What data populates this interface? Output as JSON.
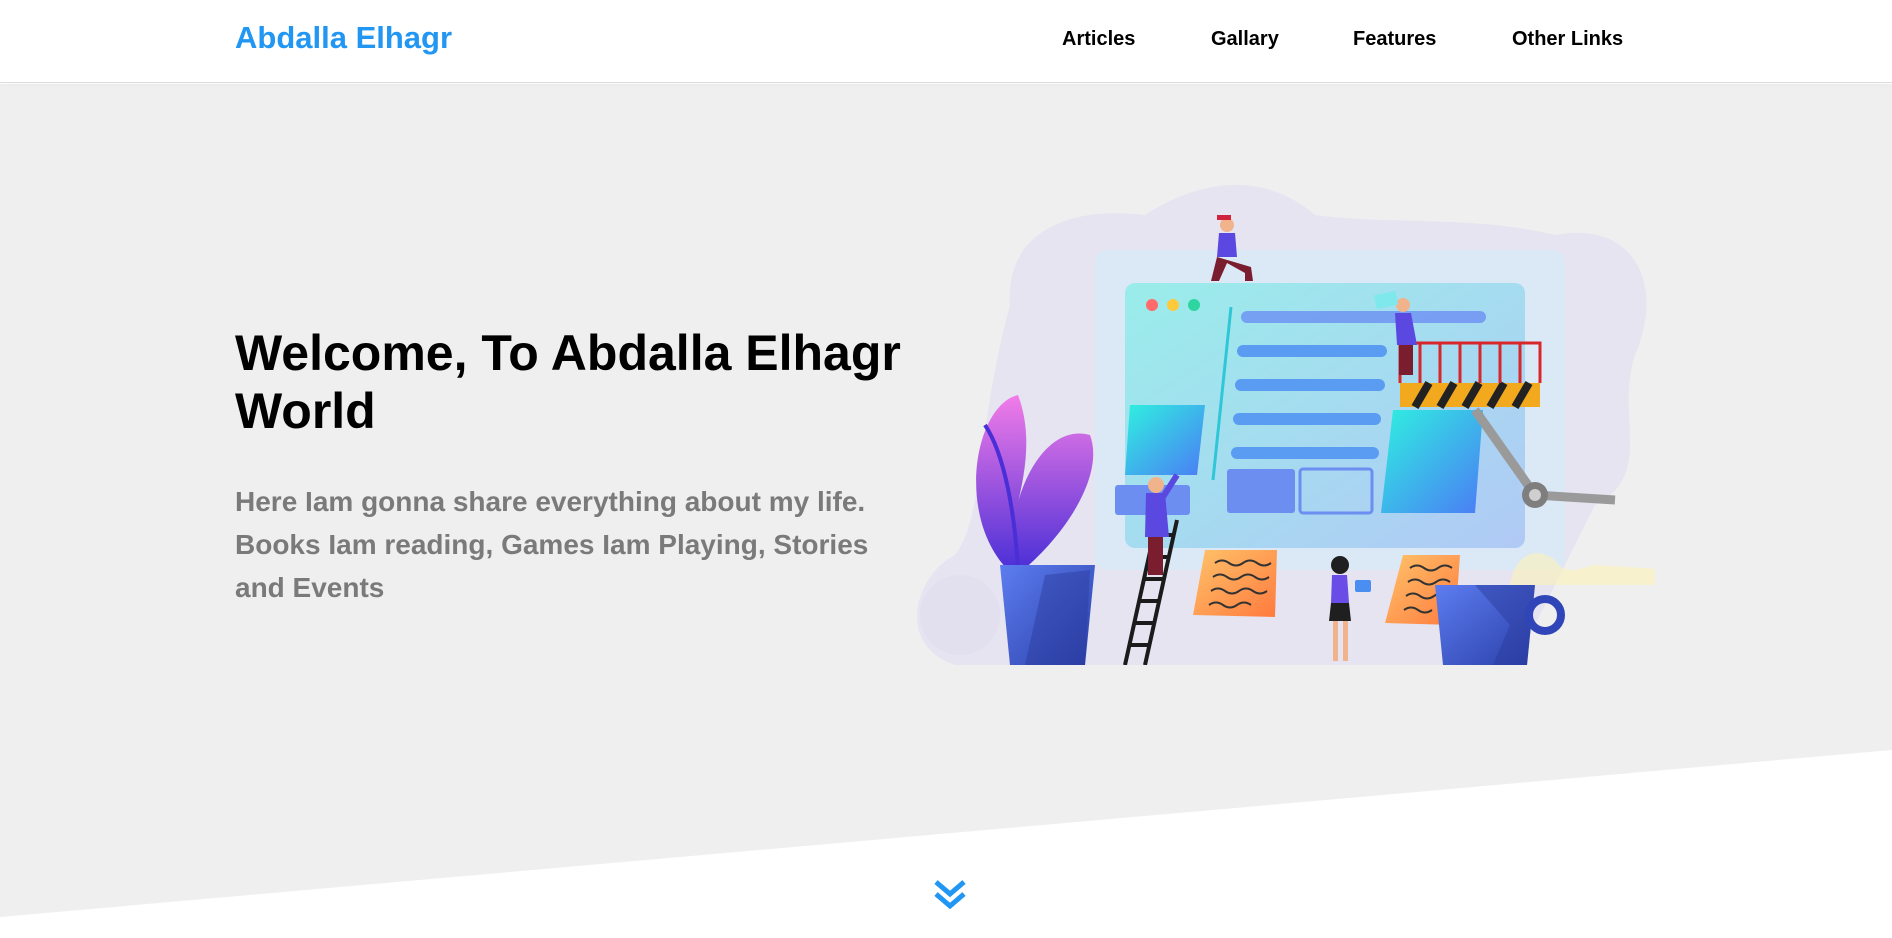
{
  "header": {
    "logo": "Abdalla Elhagr",
    "nav": [
      {
        "label": "Articles"
      },
      {
        "label": "Gallary"
      },
      {
        "label": "Features"
      },
      {
        "label": "Other Links"
      }
    ]
  },
  "landing": {
    "title": "Welcome, To Abdalla Elhagr World",
    "description": "Here Iam gonna share everything about my life. Books Iam reading, Games Iam Playing, Stories and Events",
    "illustration": "web-building-illustration",
    "scroll_icon": "double-chevron-down-icon"
  },
  "colors": {
    "accent": "#2196f3",
    "landing_bg": "#efefef",
    "text_muted": "#7a7a7a"
  }
}
